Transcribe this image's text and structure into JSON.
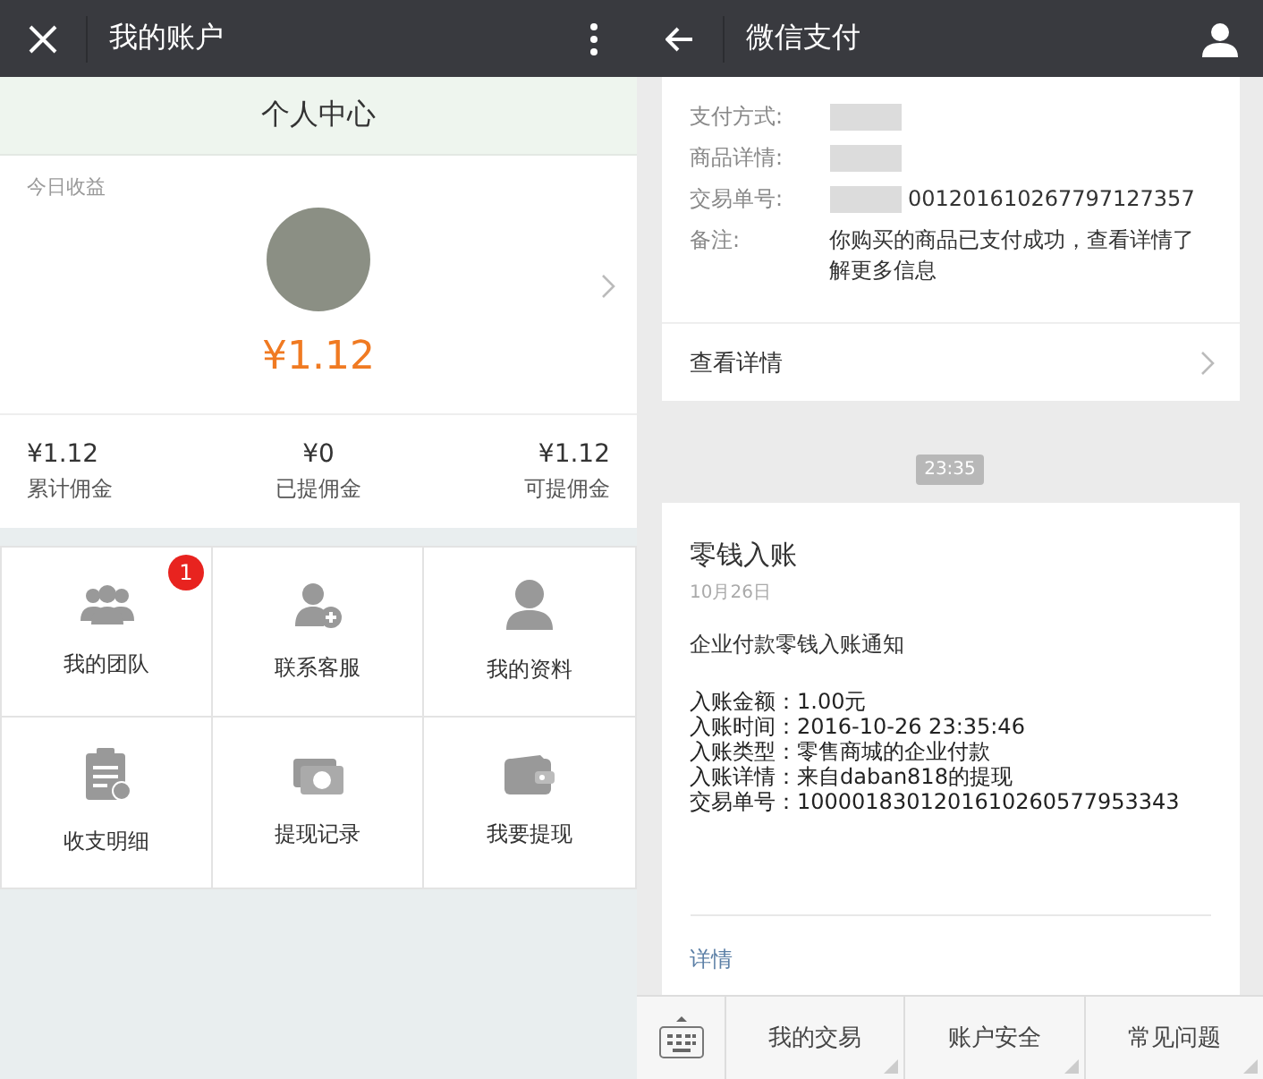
{
  "left_screen": {
    "header": {
      "title": "我的账户"
    },
    "page_title": "个人中心",
    "profile": {
      "label": "今日收益",
      "amount": "¥1.12"
    },
    "stats": [
      {
        "value": "¥1.12",
        "label": "累计佣金"
      },
      {
        "value": "¥0",
        "label": "已提佣金"
      },
      {
        "value": "¥1.12",
        "label": "可提佣金"
      }
    ],
    "menu": [
      {
        "kind": "team",
        "label": "我的团队",
        "badge": "1"
      },
      {
        "kind": "service",
        "label": "联系客服"
      },
      {
        "kind": "profile",
        "label": "我的资料"
      },
      {
        "kind": "ledger",
        "label": "收支明细"
      },
      {
        "kind": "money",
        "label": "提现记录"
      },
      {
        "kind": "wallet",
        "label": "我要提现"
      }
    ]
  },
  "right_screen": {
    "header": {
      "title": "微信支付"
    },
    "payment_card": {
      "fields": [
        {
          "label": "支付方式:",
          "redacted": true
        },
        {
          "label": "商品详情:",
          "redacted": true
        },
        {
          "label": "交易单号:",
          "redacted": true,
          "value": "001201610267797127357"
        },
        {
          "label": "备注:",
          "redacted": false,
          "value": "你购买的商品已支付成功，查看详情了解更多信息"
        }
      ],
      "link": "查看详情"
    },
    "time": "23:35",
    "notice_card": {
      "title": "零钱入账",
      "date": "10月26日",
      "subtitle": "企业付款零钱入账通知",
      "lines": [
        {
          "label": "入账金额：",
          "value": "1.00元"
        },
        {
          "label": "入账时间：",
          "value": "2016-10-26 23:35:46"
        },
        {
          "label": "入账类型：",
          "value": "零售商城的企业付款"
        },
        {
          "label": "入账详情：",
          "value": "来自daban818的提现"
        },
        {
          "label": "交易单号：",
          "value": "100001830120161026057795334​3"
        }
      ],
      "link": "详情"
    },
    "bottom_menu": [
      "我的交易",
      "账户安全",
      "常见问题"
    ]
  }
}
